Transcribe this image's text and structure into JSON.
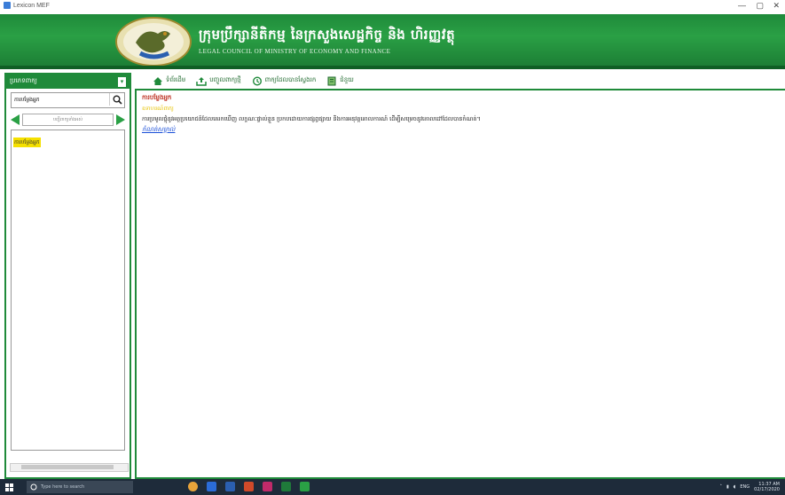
{
  "window": {
    "title": "Lexicon MEF",
    "minimize": "—",
    "restore": "▢",
    "close": "✕"
  },
  "banner": {
    "title": "ក្រុមប្រឹក្សានីតិកម្ម នៃក្រសួងសេដ្ឋកិច្ច និង ហិរញ្ញវត្ថុ",
    "subtitle": "LEGAL COUNCIL OF MINISTRY OF ECONOMY AND FINANCE"
  },
  "sidebar": {
    "header_label": "ប្រភេទពាក្យ",
    "dropdown_glyph": "▾",
    "search_value": "ការបម្លែងអ្នក",
    "nav_label": "បញ្ជីពាក្យទាំងអស់",
    "words": [
      "ការបម្លែងអ្នក"
    ]
  },
  "toolbar": {
    "items": [
      {
        "label": "ទំព័រដើម",
        "icon": "home-icon"
      },
      {
        "label": "បញ្ចូលពាក្យថ្មី",
        "icon": "upload-icon"
      },
      {
        "label": "ពាក្យដែលបានស្វែងរក",
        "icon": "history-icon"
      },
      {
        "label": "ជំនួយ",
        "icon": "book-icon"
      }
    ]
  },
  "entry": {
    "headword": "ការបម្លែងអ្នក",
    "category": "ឧទាហរណ៍ពាក្យ",
    "definition": "ការប្រមូលផ្តុំនូវអត្ថប្រយោជន៍ដែលគេរកឃើញ លក្ខណៈផ្ទាល់ខ្លួន ប្រកបដោយការផ្សព្វផ្សាយ និងការអនុវត្តគោលការណ៍ ដើម្បីសម្រេចនូវគោលដៅដែលបានកំណត់។",
    "link": "កំណត់សម្គាល់"
  },
  "taskbar": {
    "search_placeholder": "Type here to search",
    "lang": "ENG",
    "time": "11:37 AM",
    "date": "02/17/2020"
  },
  "colors": {
    "brand": "#1f8a3a",
    "highlight": "#f5e000",
    "link": "#1a4fd8",
    "headword": "#c0392b"
  }
}
